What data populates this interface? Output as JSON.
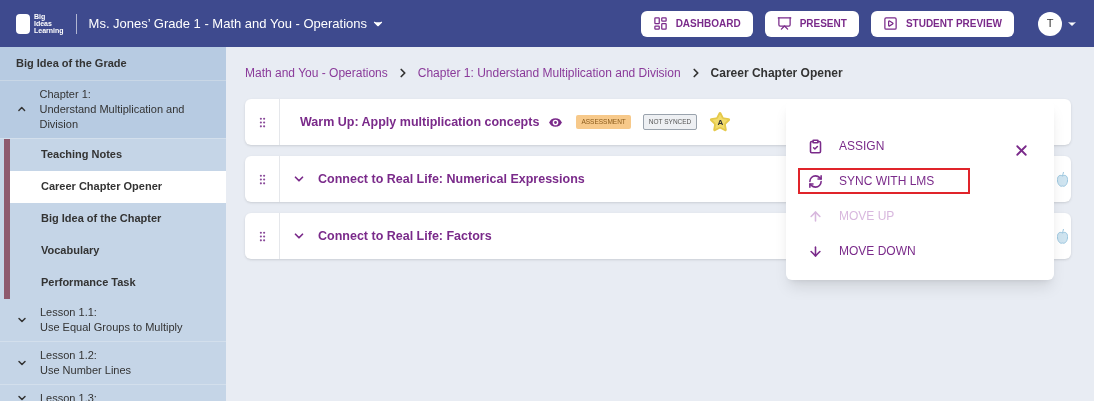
{
  "header": {
    "logo_lines": [
      "Big",
      "Ideas",
      "Learning"
    ],
    "course_title": "Ms. Jones’ Grade 1 - Math and You - Operations",
    "buttons": [
      {
        "kind": "dashboard",
        "label": "DASHBOARD"
      },
      {
        "kind": "present",
        "label": "PRESENT"
      },
      {
        "kind": "preview",
        "label": "STUDENT PREVIEW"
      }
    ],
    "avatar": "T"
  },
  "sidebar": {
    "items": [
      {
        "kind": "section",
        "label": "Big Idea of the Grade"
      },
      {
        "kind": "group",
        "title": "Chapter 1:",
        "subtitle": "Understand Multiplication and Division",
        "expanded": true,
        "children": [
          {
            "label": "Teaching Notes",
            "selected": false
          },
          {
            "label": "Career Chapter Opener",
            "selected": true
          },
          {
            "label": "Big Idea of the Chapter",
            "selected": false
          },
          {
            "label": "Vocabulary",
            "selected": false
          },
          {
            "label": "Performance Task",
            "selected": false
          }
        ]
      },
      {
        "kind": "group",
        "title": "Lesson 1.1:",
        "subtitle": "Use Equal Groups to Multiply",
        "expanded": false
      },
      {
        "kind": "group",
        "title": "Lesson 1.2:",
        "subtitle": "Use Number Lines",
        "expanded": false
      },
      {
        "kind": "group",
        "title": "Lesson 1.3:",
        "expanded": false
      }
    ]
  },
  "breadcrumbs": [
    "Math and You - Operations",
    "Chapter 1: Understand Multiplication and Division",
    "Career Chapter Opener"
  ],
  "cards": [
    {
      "title": "Warm Up: Apply multiplication concepts",
      "expandable": false,
      "visible": true,
      "tags": [
        {
          "kind": "assessment",
          "label": "ASSESSMENT"
        },
        {
          "kind": "sync",
          "label": "NOT SYNCED"
        }
      ],
      "star": "A"
    },
    {
      "title": "Connect to Real Life: Numerical Expressions",
      "expandable": true,
      "visible": false
    },
    {
      "title": "Connect to Real Life: Factors",
      "expandable": true,
      "visible": false
    }
  ],
  "menu": {
    "items": [
      {
        "kind": "assign",
        "label": "ASSIGN",
        "disabled": false,
        "highlighted": false
      },
      {
        "kind": "sync",
        "label": "SYNC WITH LMS",
        "disabled": false,
        "highlighted": true
      },
      {
        "kind": "up",
        "label": "MOVE UP",
        "disabled": true,
        "highlighted": false
      },
      {
        "kind": "down",
        "label": "MOVE DOWN",
        "disabled": false,
        "highlighted": false
      }
    ]
  }
}
